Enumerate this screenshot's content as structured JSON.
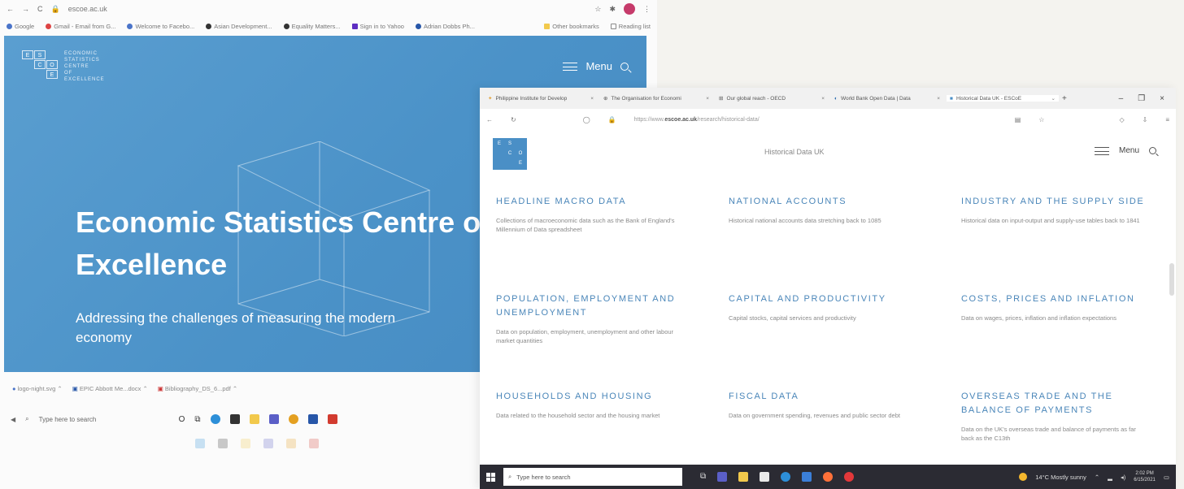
{
  "left_browser": {
    "address": "escoe.ac.uk",
    "bookmarks": [
      "Google",
      "Gmail - Email from G...",
      "Welcome to Facebo...",
      "Asian Development...",
      "Equality Matters...",
      "Sign in to Yahoo",
      "Adrian Dobbs Ph...",
      "Other bookmarks",
      "Reading list"
    ]
  },
  "hero": {
    "logo_text": [
      "ECONOMIC",
      "STATISTICS",
      "CENTRE",
      "OF",
      "EXCELLENCE"
    ],
    "menu_label": "Menu",
    "title": "Economic Statistics Centre of Excellence",
    "subtitle": "Addressing the challenges of measuring the modern economy"
  },
  "left_downloads": [
    "logo-night.svg",
    "EPIC Abbott Me...docx",
    "Bibliography_DS_6...pdf"
  ],
  "left_taskbar": {
    "search_placeholder": "Type here to search"
  },
  "right_browser": {
    "tabs": [
      {
        "label": "Philippine Institute for Develop"
      },
      {
        "label": "The Organisation for Economi"
      },
      {
        "label": "Our global reach - OECD"
      },
      {
        "label": "World Bank Open Data | Data"
      },
      {
        "label": "Historical Data UK - ESCoE"
      }
    ],
    "url_prefix": "https://www.",
    "url_domain": "escoe.ac.uk",
    "url_path": "/research/historical-data/"
  },
  "right_page": {
    "page_title": "Historical Data UK",
    "menu_label": "Menu",
    "categories": [
      {
        "title": "HEADLINE MACRO DATA",
        "desc": "Collections of macroeconomic data such as the Bank of England's Millennium of Data spreadsheet"
      },
      {
        "title": "NATIONAL ACCOUNTS",
        "desc": "Historical national accounts data stretching back to 1085"
      },
      {
        "title": "INDUSTRY AND THE SUPPLY SIDE",
        "desc": "Historical data on input-output and supply-use tables back to 1841"
      },
      {
        "title": "POPULATION, EMPLOYMENT AND UNEMPLOYMENT",
        "desc": "Data on population, employment, unemployment and other labour market quantities"
      },
      {
        "title": "CAPITAL AND PRODUCTIVITY",
        "desc": "Capital stocks, capital services and productivity"
      },
      {
        "title": "COSTS, PRICES AND INFLATION",
        "desc": "Data on wages, prices, inflation and inflation expectations"
      },
      {
        "title": "HOUSEHOLDS AND HOUSING",
        "desc": "Data related to the household sector and the housing market"
      },
      {
        "title": "FISCAL DATA",
        "desc": "Data on government spending, revenues and public sector debt"
      },
      {
        "title": "OVERSEAS TRADE AND THE BALANCE OF PAYMENTS",
        "desc": "Data on the UK's overseas trade and balance of payments as far back as the C13th"
      }
    ]
  },
  "right_taskbar": {
    "search_placeholder": "Type here to search",
    "weather": "14°C  Mostly sunny",
    "time": "2:02 PM",
    "date": "6/15/2021"
  },
  "colors": {
    "hero_blue": "#4b92c8",
    "heading_blue": "#4a86b9"
  }
}
